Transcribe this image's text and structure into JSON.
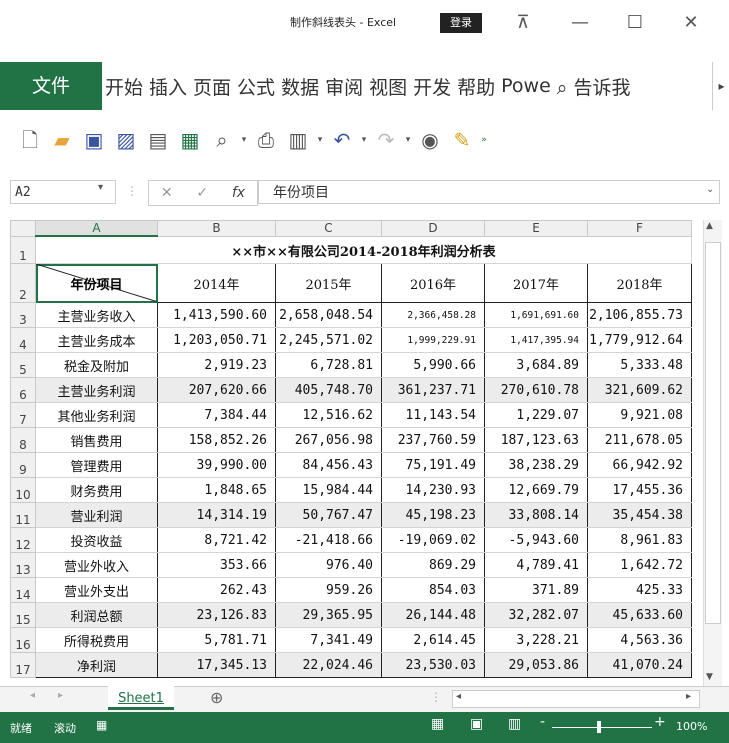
{
  "window": {
    "title": "制作斜线表头 - Excel",
    "login_label": "登录",
    "restore_icon": "⊼",
    "minimize_icon": "—",
    "maximize_icon": "☐",
    "close_icon": "✕"
  },
  "ribbon": {
    "file_tab": "文件",
    "tabs": [
      "开始",
      "插入",
      "页面",
      "公式",
      "数据",
      "审阅",
      "视图",
      "开发",
      "帮助",
      "Powe",
      "⌕ 告诉我"
    ],
    "scroll_label": "▸"
  },
  "toolbar": {
    "icons": [
      "new-file-icon",
      "open-folder-icon",
      "save-icon",
      "save-as-icon",
      "print-preview-icon",
      "export-icon",
      "page-preview-icon",
      "print-icon",
      "table-icon",
      "undo-icon",
      "redo-icon",
      "camera-icon",
      "format-painter-icon",
      "more-icon"
    ]
  },
  "formula_bar": {
    "name_box": "A2",
    "fx_label": "fx",
    "content": "年份项目"
  },
  "sheet": {
    "columns": [
      "A",
      "B",
      "C",
      "D",
      "E",
      "F"
    ],
    "title": "××市××有限公司2014-2018年利润分析表",
    "header_label": "年份项目",
    "years": [
      "2014年",
      "2015年",
      "2016年",
      "2017年",
      "2018年"
    ],
    "rows": [
      {
        "n": "3",
        "item": "主营业务收入",
        "v": [
          "1,413,590.60",
          "2,658,048.54",
          "2,366,458.28",
          "1,691,691.60",
          "2,106,855.73"
        ],
        "shade": false
      },
      {
        "n": "4",
        "item": "主营业务成本",
        "v": [
          "1,203,050.71",
          "2,245,571.02",
          "1,999,229.91",
          "1,417,395.94",
          "1,779,912.64"
        ],
        "shade": false
      },
      {
        "n": "5",
        "item": "税金及附加",
        "v": [
          "2,919.23",
          "6,728.81",
          "5,990.66",
          "3,684.89",
          "5,333.48"
        ],
        "shade": false
      },
      {
        "n": "6",
        "item": "主营业务利润",
        "v": [
          "207,620.66",
          "405,748.70",
          "361,237.71",
          "270,610.78",
          "321,609.62"
        ],
        "shade": true
      },
      {
        "n": "7",
        "item": "其他业务利润",
        "v": [
          "7,384.44",
          "12,516.62",
          "11,143.54",
          "1,229.07",
          "9,921.08"
        ],
        "shade": false
      },
      {
        "n": "8",
        "item": "销售费用",
        "v": [
          "158,852.26",
          "267,056.98",
          "237,760.59",
          "187,123.63",
          "211,678.05"
        ],
        "shade": false
      },
      {
        "n": "9",
        "item": "管理费用",
        "v": [
          "39,990.00",
          "84,456.43",
          "75,191.49",
          "38,238.29",
          "66,942.92"
        ],
        "shade": false
      },
      {
        "n": "10",
        "item": "财务费用",
        "v": [
          "1,848.65",
          "15,984.44",
          "14,230.93",
          "12,669.79",
          "17,455.36"
        ],
        "shade": false
      },
      {
        "n": "11",
        "item": "营业利润",
        "v": [
          "14,314.19",
          "50,767.47",
          "45,198.23",
          "33,808.14",
          "35,454.38"
        ],
        "shade": true
      },
      {
        "n": "12",
        "item": "投资收益",
        "v": [
          "8,721.42",
          "-21,418.66",
          "-19,069.02",
          "-5,943.60",
          "8,961.83"
        ],
        "shade": false
      },
      {
        "n": "13",
        "item": "营业外收入",
        "v": [
          "353.66",
          "976.40",
          "869.29",
          "4,789.41",
          "1,642.72"
        ],
        "shade": false
      },
      {
        "n": "14",
        "item": "营业外支出",
        "v": [
          "262.43",
          "959.26",
          "854.03",
          "371.89",
          "425.33"
        ],
        "shade": false
      },
      {
        "n": "15",
        "item": "利润总额",
        "v": [
          "23,126.83",
          "29,365.95",
          "26,144.48",
          "32,282.07",
          "45,633.60"
        ],
        "shade": true
      },
      {
        "n": "16",
        "item": "所得税费用",
        "v": [
          "5,781.71",
          "7,341.49",
          "2,614.45",
          "3,228.21",
          "4,563.36"
        ],
        "shade": false
      },
      {
        "n": "17",
        "item": "净利润",
        "v": [
          "17,345.13",
          "22,024.46",
          "23,530.03",
          "29,053.86",
          "41,070.24"
        ],
        "shade": true
      }
    ]
  },
  "sheet_tabs": {
    "active": "Sheet1",
    "add_label": "⊕"
  },
  "status": {
    "ready": "就绪",
    "scroll": "滚动",
    "zoom": "100%",
    "zoom_minus": "-",
    "zoom_plus": "+"
  },
  "colors": {
    "accent": "#217346"
  }
}
